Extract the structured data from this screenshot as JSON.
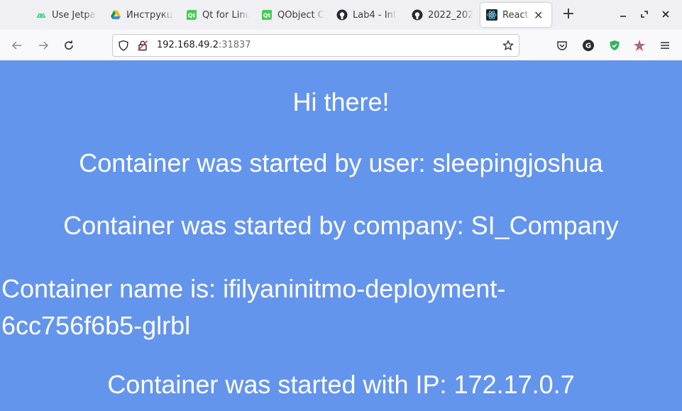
{
  "tabs": [
    {
      "label": "Use Jetpa",
      "icon": "android-icon"
    },
    {
      "label": "Инструкц",
      "icon": "google-drive-icon"
    },
    {
      "label": "Qt for Linu",
      "icon": "qt-icon"
    },
    {
      "label": "QObject C",
      "icon": "qt-icon"
    },
    {
      "label": "Lab4 - Int",
      "icon": "github-icon"
    },
    {
      "label": "2022_202",
      "icon": "github-icon"
    },
    {
      "label": "React A",
      "icon": "react-icon",
      "active": true
    }
  ],
  "address_bar": {
    "host": "192.168.49.2",
    "port": ":31837"
  },
  "page": {
    "greeting": "Hi there!",
    "user_line": "Container was started by user: sleepingjoshua",
    "company_line": "Container was started by company: SI_Company",
    "name_line_1": "Container name is: ifilyaninitmo-deployment-",
    "name_line_2": "6cc756f6b5-glrbl",
    "ip_line": "Container was started with IP: 172.17.0.7"
  },
  "colors": {
    "page_background": "#6495ed",
    "page_text": "#ffffff",
    "tabstrip": "#f0f0f4"
  }
}
